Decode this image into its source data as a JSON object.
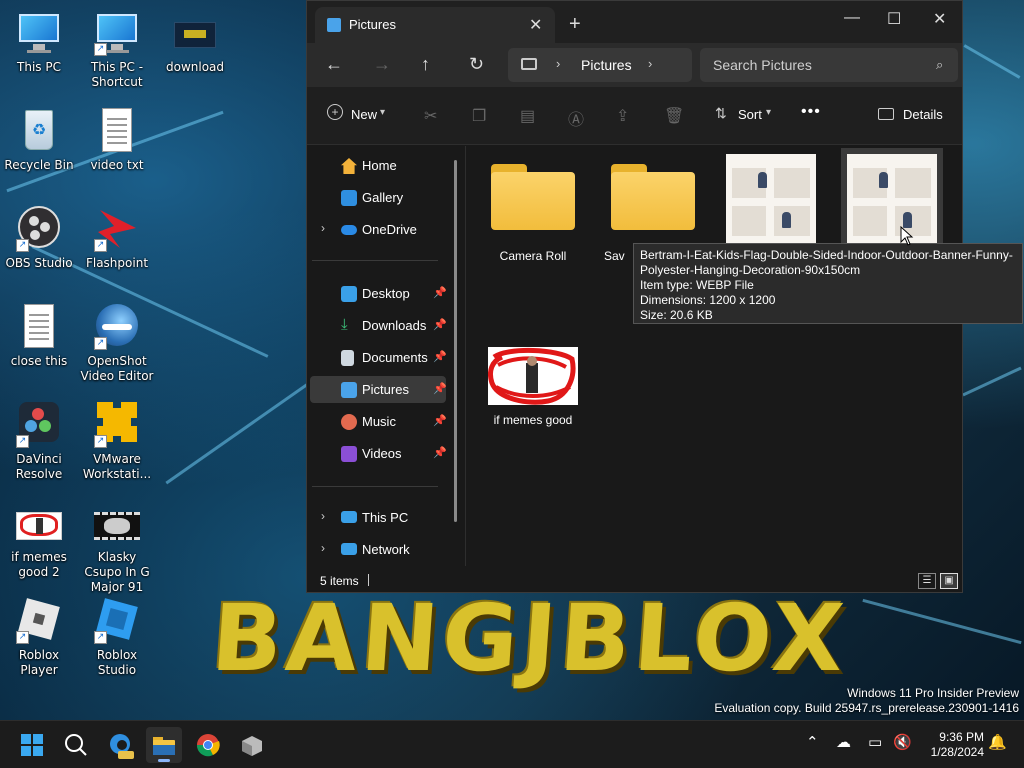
{
  "desktop": {
    "icons": [
      {
        "label": "This PC",
        "icon": "monitor-icon"
      },
      {
        "label": "This PC - Shortcut",
        "icon": "monitor-icon"
      },
      {
        "label": "download",
        "icon": "image-file-icon"
      },
      {
        "label": "Recycle Bin",
        "icon": "recycle-bin-icon"
      },
      {
        "label": "video txt",
        "icon": "text-file-icon"
      },
      {
        "label": "OBS Studio",
        "icon": "obs-icon"
      },
      {
        "label": "Flashpoint",
        "icon": "flashpoint-icon"
      },
      {
        "label": "close this",
        "icon": "text-file-icon"
      },
      {
        "label": "OpenShot Video Editor",
        "icon": "openshot-icon"
      },
      {
        "label": "DaVinci Resolve",
        "icon": "davinci-icon"
      },
      {
        "label": "VMware Workstati...",
        "icon": "vmware-icon"
      },
      {
        "label": "if memes good 2",
        "icon": "image-file-icon"
      },
      {
        "label": "Klasky Csupo In G Major 91",
        "icon": "video-file-icon"
      },
      {
        "label": "Roblox Player",
        "icon": "roblox-icon"
      },
      {
        "label": "Roblox Studio",
        "icon": "roblox-studio-icon"
      }
    ],
    "wallpaper_text": "BANGJBLOX"
  },
  "explorer": {
    "tab_title": "Pictures",
    "address_crumb": "Pictures",
    "search_placeholder": "Search Pictures",
    "toolbar": {
      "new_label": "New",
      "sort_label": "Sort",
      "details_label": "Details"
    },
    "nav": {
      "home": "Home",
      "gallery": "Gallery",
      "onedrive": "OneDrive",
      "desktop": "Desktop",
      "downloads": "Downloads",
      "documents": "Documents",
      "pictures": "Pictures",
      "music": "Music",
      "videos": "Videos",
      "thispc": "This PC",
      "network": "Network"
    },
    "files": [
      {
        "name": "Camera Roll",
        "type": "folder"
      },
      {
        "name": "Sav",
        "type": "folder"
      },
      {
        "name": "",
        "type": "image"
      },
      {
        "name": "",
        "type": "image"
      },
      {
        "name": "if memes good",
        "type": "image"
      }
    ],
    "tooltip": {
      "line1": "Bertram-I-Eat-Kids-Flag-Double-Sided-Indoor-Outdoor-Banner-Funny-",
      "line2": "Polyester-Hanging-Decoration-90x150cm",
      "line3": "Item type: WEBP File",
      "line4": "Dimensions: 1200 x 1200",
      "line5": "Size: 20.6 KB"
    },
    "status_count": "5 items"
  },
  "watermark": {
    "line1": "Windows 11 Pro Insider Preview",
    "line2": "Evaluation copy. Build 25947.rs_prerelease.230901-1416"
  },
  "taskbar": {
    "time": "9:36 PM",
    "date": "1/28/2024"
  },
  "colors": {
    "accent": "#8ab4f8",
    "folder": "#f2bd3c",
    "window_bg": "#191919"
  }
}
